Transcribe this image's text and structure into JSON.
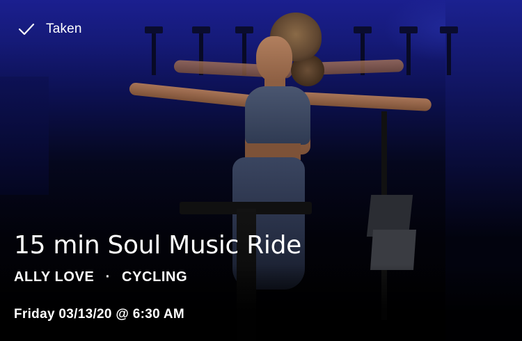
{
  "status": {
    "icon": "check-icon",
    "label": "Taken"
  },
  "class": {
    "title": "15 min Soul Music Ride",
    "instructor": "ALLY LOVE",
    "separator": "·",
    "discipline": "CYCLING",
    "datetime": "Friday 03/13/20 @ 6:30 AM"
  },
  "hero_image": {
    "subject": "instructor on bike with arms extended, blue-lit studio"
  },
  "colors": {
    "text": "#ffffff",
    "background_top": "#1b1f8f",
    "background_bottom": "#000000"
  }
}
